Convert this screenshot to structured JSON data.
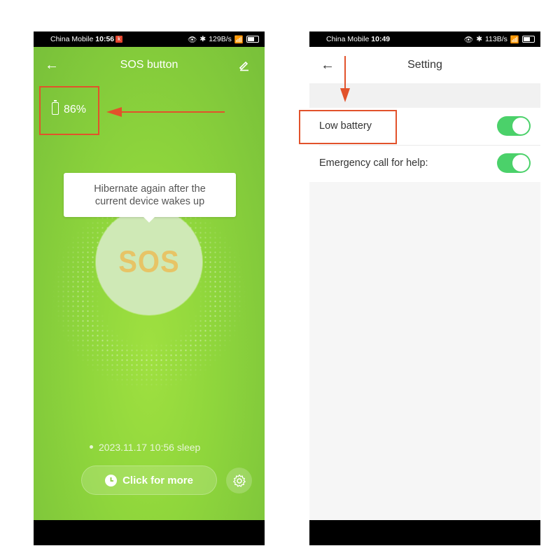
{
  "left_screen": {
    "status_bar": {
      "carrier": "China Mobile",
      "time": "10:56",
      "net_speed": "129B/s"
    },
    "header": {
      "title": "SOS button",
      "back_icon": "back-arrow-icon",
      "edit_icon": "edit-pencil-icon"
    },
    "battery": {
      "percent": "86%",
      "level": 0.86
    },
    "tooltip": {
      "line1": "Hibernate again after the",
      "line2": "current device wakes up"
    },
    "sos_label": "SOS",
    "status_line": "2023.11.17 10:56 sleep",
    "more_button": {
      "label": "Click for more",
      "icon": "clock-icon"
    },
    "settings_icon": "gear-icon"
  },
  "right_screen": {
    "status_bar": {
      "carrier": "China Mobile",
      "time": "10:49",
      "net_speed": "113B/s"
    },
    "header": {
      "title": "Setting",
      "back_icon": "back-arrow-icon"
    },
    "settings": [
      {
        "label": "Low battery",
        "enabled": true
      },
      {
        "label": "Emergency call for help:",
        "enabled": true
      }
    ]
  },
  "colors": {
    "accent_green": "#87cc3c",
    "toggle_on": "#4bd16a",
    "annotation_red": "#e2522b",
    "sos_text": "#e7c466"
  }
}
